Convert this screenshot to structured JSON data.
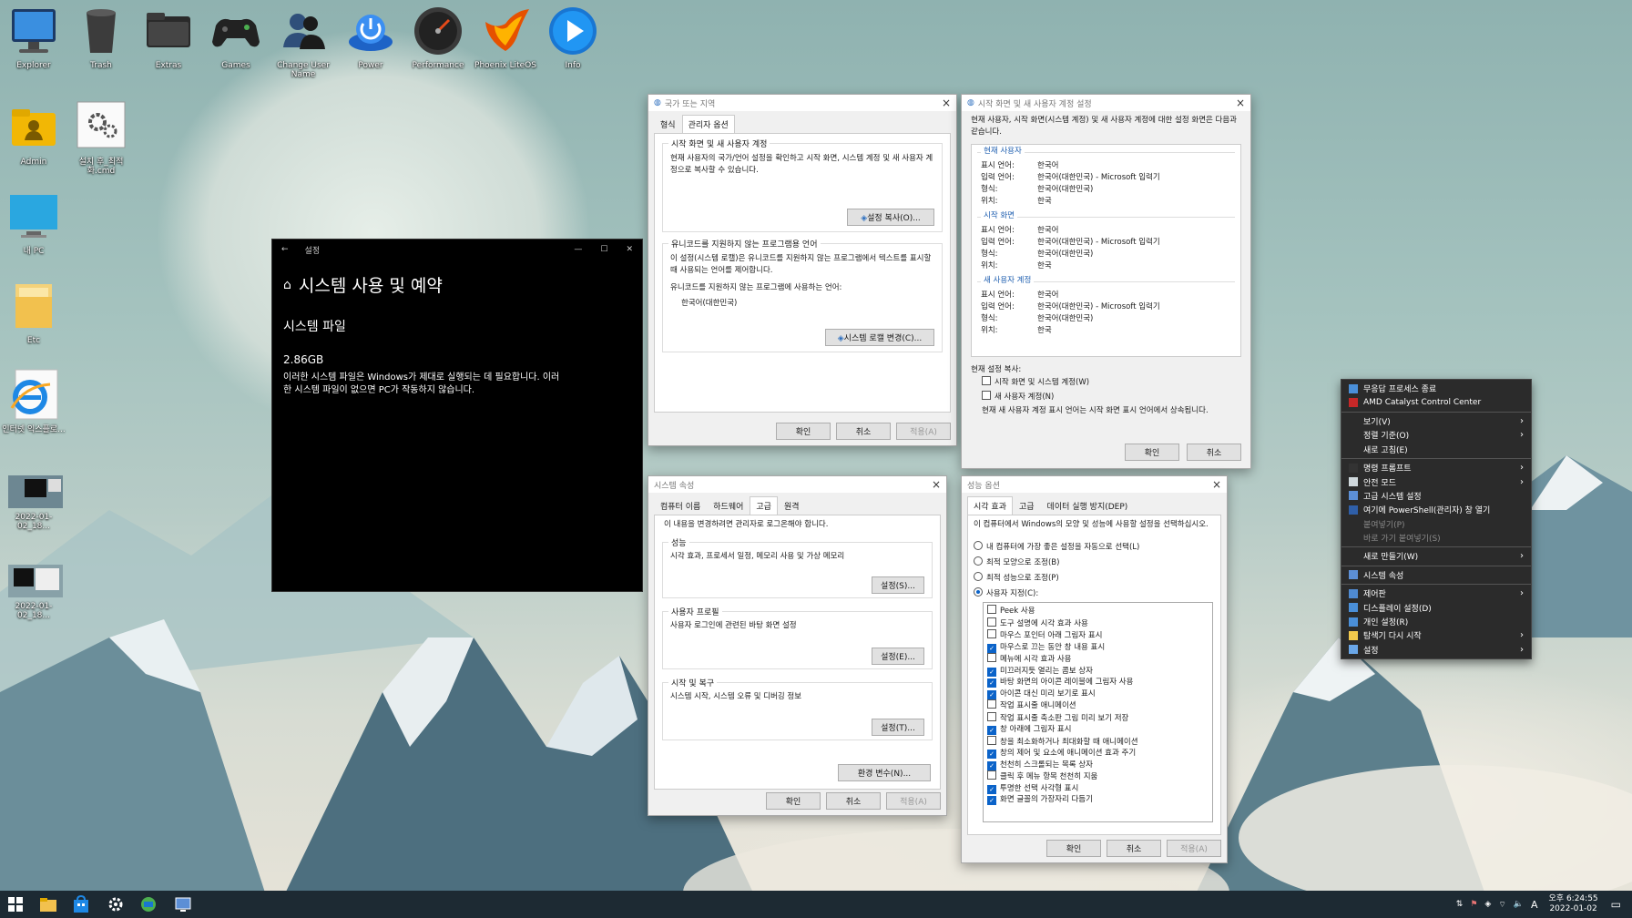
{
  "desktop": {
    "icons": [
      {
        "label": "Explorer"
      },
      {
        "label": "Trash"
      },
      {
        "label": "Extras"
      },
      {
        "label": "Games"
      },
      {
        "label": "Change User Name"
      },
      {
        "label": "Power"
      },
      {
        "label": "Performance"
      },
      {
        "label": "Phoenix LiteOS"
      },
      {
        "label": "Info"
      },
      {
        "label": "Admin"
      },
      {
        "label": "설치 후_최적화.cmd"
      },
      {
        "label": "내 PC"
      },
      {
        "label": "Etc"
      },
      {
        "label": "인터넷 익스플로..."
      },
      {
        "label": "2022-01-02_18..."
      },
      {
        "label": "2022-01-02_18..."
      }
    ]
  },
  "settings_window": {
    "titlebar": "설정",
    "heading": "시스템 사용 및 예약",
    "section": "시스템 파일",
    "size": "2.86GB",
    "description": "이러한 시스템 파일은 Windows가 제대로 실행되는 데 필요합니다. 이러한 시스템 파일이 없으면 PC가 작동하지 않습니다."
  },
  "region_window": {
    "title": "국가 또는 지역",
    "tabs": [
      "형식",
      "관리자 옵션"
    ],
    "group1_title": "시작 화면 및 새 사용자 계정",
    "group1_text": "현재 사용자의 국가/언어 설정을 확인하고 시작 화면, 시스템 계정 및 새 사용자 계정으로 복사할 수 있습니다.",
    "copy_button": "설정 복사(O)...",
    "group2_title": "유니코드를 지원하지 않는 프로그램용 언어",
    "group2_text": "이 설정(시스템 로캘)은 유니코드를 지원하지 않는 프로그램에서 텍스트를 표시할 때 사용되는 언어를 제어합니다.",
    "current_label": "유니코드를 지원하지 않는 프로그램에 사용하는 언어:",
    "current_value": "한국어(대한민국)",
    "locale_button": "시스템 로캘 변경(C)...",
    "ok": "확인",
    "cancel": "취소",
    "apply": "적용(A)"
  },
  "welcome_window": {
    "title": "시작 화면 및 새 사용자 계정 설정",
    "intro": "현재 사용자, 시작 화면(시스템 계정) 및 새 사용자 계정에 대한 설정 화면은 다음과 같습니다.",
    "sections": [
      {
        "name": "현재 사용자",
        "rows": [
          [
            "표시 언어:",
            "한국어"
          ],
          [
            "입력 언어:",
            "한국어(대한민국) - Microsoft 입력기"
          ],
          [
            "형식:",
            "한국어(대한민국)"
          ],
          [
            "위치:",
            "한국"
          ]
        ]
      },
      {
        "name": "시작 화면",
        "rows": [
          [
            "표시 언어:",
            "한국어"
          ],
          [
            "입력 언어:",
            "한국어(대한민국) - Microsoft 입력기"
          ],
          [
            "형식:",
            "한국어(대한민국)"
          ],
          [
            "위치:",
            "한국"
          ]
        ]
      },
      {
        "name": "새 사용자 계정",
        "rows": [
          [
            "표시 언어:",
            "한국어"
          ],
          [
            "입력 언어:",
            "한국어(대한민국) - Microsoft 입력기"
          ],
          [
            "형식:",
            "한국어(대한민국)"
          ],
          [
            "위치:",
            "한국"
          ]
        ]
      }
    ],
    "copy_label": "현재 설정 복사:",
    "check1": "시작 화면 및 시스템 계정(W)",
    "check2": "새 사용자 계정(N)",
    "note": "현재 새 사용자 계정 표시 언어는 시작 화면 표시 언어에서 상속됩니다.",
    "ok": "확인",
    "cancel": "취소"
  },
  "sysprops_window": {
    "title": "시스템 속성",
    "tabs": [
      "컴퓨터 이름",
      "하드웨어",
      "고급",
      "원격"
    ],
    "admin_note": "이 내용을 변경하려면 관리자로 로그온해야 합니다.",
    "perf_title": "성능",
    "perf_text": "시각 효과, 프로세서 일정, 메모리 사용 및 가상 메모리",
    "perf_btn": "설정(S)...",
    "profile_title": "사용자 프로필",
    "profile_text": "사용자 로그인에 관련된 바탕 화면 설정",
    "profile_btn": "설정(E)...",
    "startup_title": "시작 및 복구",
    "startup_text": "시스템 시작, 시스템 오류 및 디버깅 정보",
    "startup_btn": "설정(T)...",
    "env_btn": "환경 변수(N)...",
    "ok": "확인",
    "cancel": "취소",
    "apply": "적용(A)"
  },
  "perf_window": {
    "title": "성능 옵션",
    "tabs": [
      "시각 효과",
      "고급",
      "데이터 실행 방지(DEP)"
    ],
    "intro": "이 컴퓨터에서 Windows의 모양 및 성능에 사용할 설정을 선택하십시오.",
    "radios": [
      {
        "label": "내 컴퓨터에 가장 좋은 설정을 자동으로 선택(L)",
        "on": false
      },
      {
        "label": "최적 모양으로 조정(B)",
        "on": false
      },
      {
        "label": "최적 성능으로 조정(P)",
        "on": false
      },
      {
        "label": "사용자 지정(C):",
        "on": true
      }
    ],
    "options": [
      {
        "label": "Peek 사용",
        "on": false
      },
      {
        "label": "도구 설명에 시각 효과 사용",
        "on": false
      },
      {
        "label": "마우스 포인터 아래 그림자 표시",
        "on": false
      },
      {
        "label": "마우스로 끄는 동안 창 내용 표시",
        "on": true
      },
      {
        "label": "메뉴에 시각 효과 사용",
        "on": false
      },
      {
        "label": "미끄러지듯 열리는 콤보 상자",
        "on": true
      },
      {
        "label": "바탕 화면의 아이콘 레이블에 그림자 사용",
        "on": true
      },
      {
        "label": "아이콘 대신 미리 보기로 표시",
        "on": true
      },
      {
        "label": "작업 표시줄 애니메이션",
        "on": false
      },
      {
        "label": "작업 표시줄 축소판 그림 미리 보기 저장",
        "on": false
      },
      {
        "label": "창 아래에 그림자 표시",
        "on": true
      },
      {
        "label": "창을 최소화하거나 최대화할 때 애니메이션",
        "on": false
      },
      {
        "label": "창의 제어 및 요소에 애니메이션 효과 주기",
        "on": true
      },
      {
        "label": "천천히 스크롤되는 목록 상자",
        "on": true
      },
      {
        "label": "클릭 후 메뉴 항목 천천히 지움",
        "on": false
      },
      {
        "label": "투명한 선택 사각형 표시",
        "on": true
      },
      {
        "label": "화면 글꼴의 가장자리 다듬기",
        "on": true
      }
    ],
    "ok": "확인",
    "cancel": "취소",
    "apply": "적용(A)"
  },
  "context_menu": {
    "items": [
      {
        "label": "무응답 프로세스 종료",
        "icon": "#4a8fd8",
        "arrow": false
      },
      {
        "label": "AMD Catalyst Control Center",
        "icon": "#c62828",
        "arrow": false
      },
      {
        "sep": true
      },
      {
        "label": "보기(V)",
        "arrow": true
      },
      {
        "label": "정렬 기준(O)",
        "arrow": true
      },
      {
        "label": "새로 고침(E)",
        "arrow": false
      },
      {
        "sep": true
      },
      {
        "label": "명령 프롬프트",
        "icon": "#333333",
        "arrow": true
      },
      {
        "label": "안전 모드",
        "icon": "#cfd8dc",
        "arrow": true
      },
      {
        "label": "고급 시스템 설정",
        "icon": "#5c8fd6",
        "arrow": false
      },
      {
        "label": "여기에 PowerShell(관리자) 창 열기",
        "icon": "#2f5fa8",
        "arrow": false
      },
      {
        "label": "붙여넣기(P)",
        "disabled": true,
        "arrow": false
      },
      {
        "label": "바로 가기 붙여넣기(S)",
        "disabled": true,
        "arrow": false
      },
      {
        "sep": true
      },
      {
        "label": "새로 만들기(W)",
        "arrow": true
      },
      {
        "sep": true
      },
      {
        "label": "시스템 속성",
        "icon": "#5c8fd6",
        "arrow": false
      },
      {
        "sep": true
      },
      {
        "label": "제어판",
        "icon": "#4f8ad1",
        "arrow": true
      },
      {
        "label": "디스플레이 설정(D)",
        "icon": "#4a8fd8",
        "arrow": false
      },
      {
        "label": "개인 설정(R)",
        "icon": "#4a8fd8",
        "arrow": false
      },
      {
        "label": "탐색기 다시 시작",
        "icon": "#f2c94c",
        "arrow": true
      },
      {
        "label": "설정",
        "icon": "#6aa7e8",
        "arrow": true
      }
    ]
  },
  "taskbar": {
    "time": "오후 6:24:55",
    "date": "2022-01-02",
    "ime": "A"
  }
}
